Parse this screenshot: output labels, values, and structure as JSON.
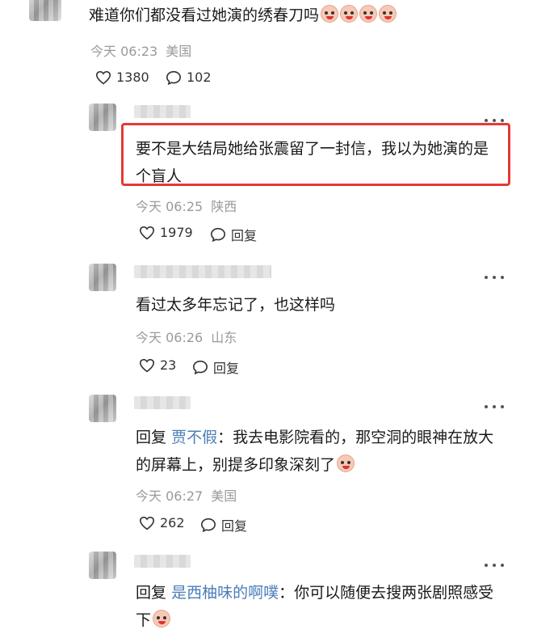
{
  "comments": [
    {
      "text": "难道你们都没看过她演的绣春刀吗",
      "time": "今天 06:23",
      "location": "美国",
      "likes": "1380",
      "replies": "102"
    },
    {
      "text": "要不是大结局她给张震留了一封信，我以为她演的是个盲人",
      "time": "今天 06:25",
      "location": "陕西",
      "likes": "1979",
      "reply_label": "回复"
    },
    {
      "text": "看过太多年忘记了，也这样吗",
      "time": "今天 06:26",
      "location": "山东",
      "likes": "23",
      "reply_label": "回复"
    },
    {
      "reply_prefix": "回复",
      "reply_to": "贾不假",
      "text": "：我去电影院看的，那空洞的眼神在放大的屏幕上，别提多印象深刻了",
      "time": "今天 06:27",
      "location": "美国",
      "likes": "262",
      "reply_label": "回复"
    },
    {
      "reply_prefix": "回复",
      "reply_to": "是西柚味的啊噗",
      "text": "：你可以随便去搜两张剧照感受下"
    }
  ],
  "icons": {
    "like": "heart-outline-icon",
    "comment": "speech-bubble-icon",
    "more": "more-dots-icon",
    "emoji": "crying-laugh-emoji-icon"
  },
  "colors": {
    "highlight_border": "#e53935",
    "reply_name": "#4a7db8",
    "meta": "#9a9a9a"
  }
}
